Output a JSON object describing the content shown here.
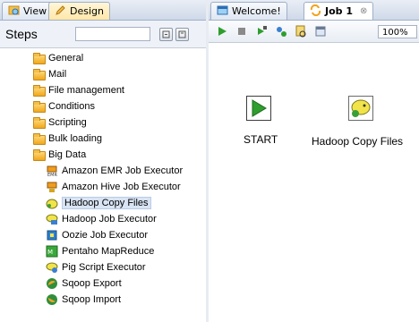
{
  "left_panel": {
    "tabs": [
      {
        "label": "View",
        "icon": "view-icon"
      },
      {
        "label": "Design",
        "icon": "design-pencil-icon"
      }
    ],
    "steps_title": "Steps",
    "search_value": "",
    "categories": [
      {
        "label": "General"
      },
      {
        "label": "Mail"
      },
      {
        "label": "File management"
      },
      {
        "label": "Conditions"
      },
      {
        "label": "Scripting"
      },
      {
        "label": "Bulk loading"
      },
      {
        "label": "Big Data"
      }
    ],
    "big_data_steps": [
      {
        "label": "Amazon EMR Job Executor",
        "icon": "amazon-emr-icon"
      },
      {
        "label": "Amazon Hive Job Executor",
        "icon": "amazon-hive-icon"
      },
      {
        "label": "Hadoop Copy Files",
        "icon": "hadoop-copy-files-icon"
      },
      {
        "label": "Hadoop Job Executor",
        "icon": "hadoop-job-executor-icon"
      },
      {
        "label": "Oozie Job Executor",
        "icon": "oozie-icon"
      },
      {
        "label": "Pentaho MapReduce",
        "icon": "pentaho-mapreduce-icon"
      },
      {
        "label": "Pig Script Executor",
        "icon": "pig-script-icon"
      },
      {
        "label": "Sqoop Export",
        "icon": "sqoop-export-icon"
      },
      {
        "label": "Sqoop Import",
        "icon": "sqoop-import-icon"
      }
    ]
  },
  "right_panel": {
    "tabs": [
      {
        "label": "Welcome!",
        "icon": "welcome-icon"
      },
      {
        "label": "Job 1",
        "icon": "job-icon",
        "close": "⊗"
      }
    ],
    "toolbar": {
      "zoom": "100%"
    },
    "canvas_nodes": [
      {
        "label": "START",
        "icon": "start-play-icon"
      },
      {
        "label": "Hadoop Copy Files",
        "icon": "hadoop-elephant-icon"
      }
    ]
  },
  "colors": {
    "accent_green": "#2e9e2e",
    "selection_bg": "#d8e4f4",
    "folder": "#f0a81a"
  }
}
